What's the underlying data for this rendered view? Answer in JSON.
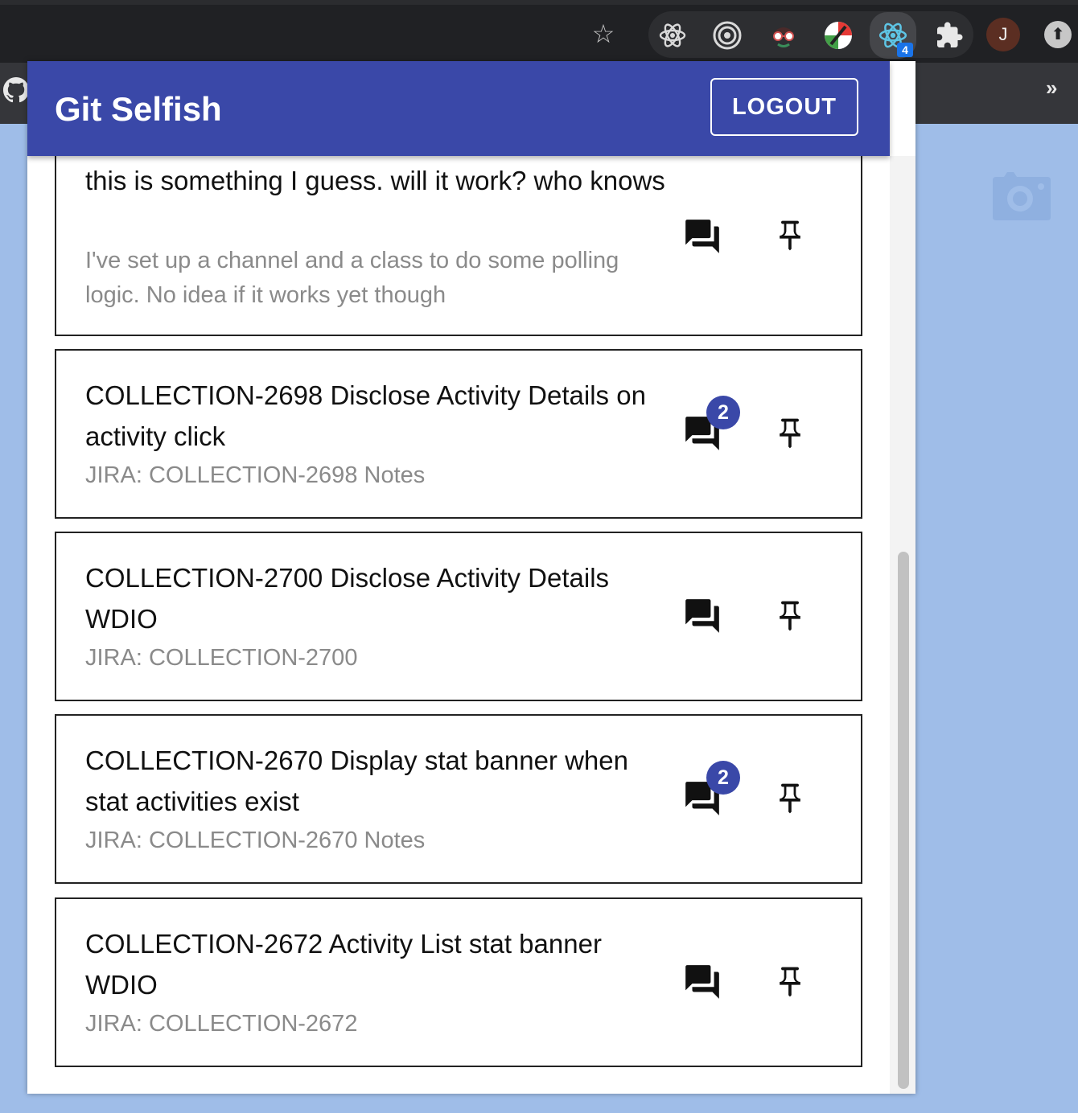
{
  "browser": {
    "extensions": [
      "react-devtools-icon",
      "target-icon",
      "spy-icon",
      "color-picker-icon",
      "react-icon",
      "puzzle-icon"
    ],
    "active_extension_badge": "4",
    "profile_initial": "J",
    "bookmarks_overflow": "»"
  },
  "app": {
    "title": "Git Selfish",
    "logout_label": "LOGOUT",
    "accent_color": "#3a48a8"
  },
  "pull_requests": [
    {
      "title": "this is something I guess. will it work? who knows",
      "subtitle": "I've set up a channel and a class to do some polling logic. No idea if it works yet though",
      "comment_count": null
    },
    {
      "title": "COLLECTION-2698 Disclose Activity Details on activity click",
      "subtitle": "JIRA: COLLECTION-2698 Notes",
      "comment_count": "2"
    },
    {
      "title": "COLLECTION-2700 Disclose Activity Details WDIO",
      "subtitle": "JIRA: COLLECTION-2700",
      "comment_count": null
    },
    {
      "title": "COLLECTION-2670 Display stat banner when stat activities exist",
      "subtitle": "JIRA: COLLECTION-2670 Notes",
      "comment_count": "2"
    },
    {
      "title": "COLLECTION-2672 Activity List stat banner WDIO",
      "subtitle": "JIRA: COLLECTION-2672",
      "comment_count": null
    }
  ]
}
